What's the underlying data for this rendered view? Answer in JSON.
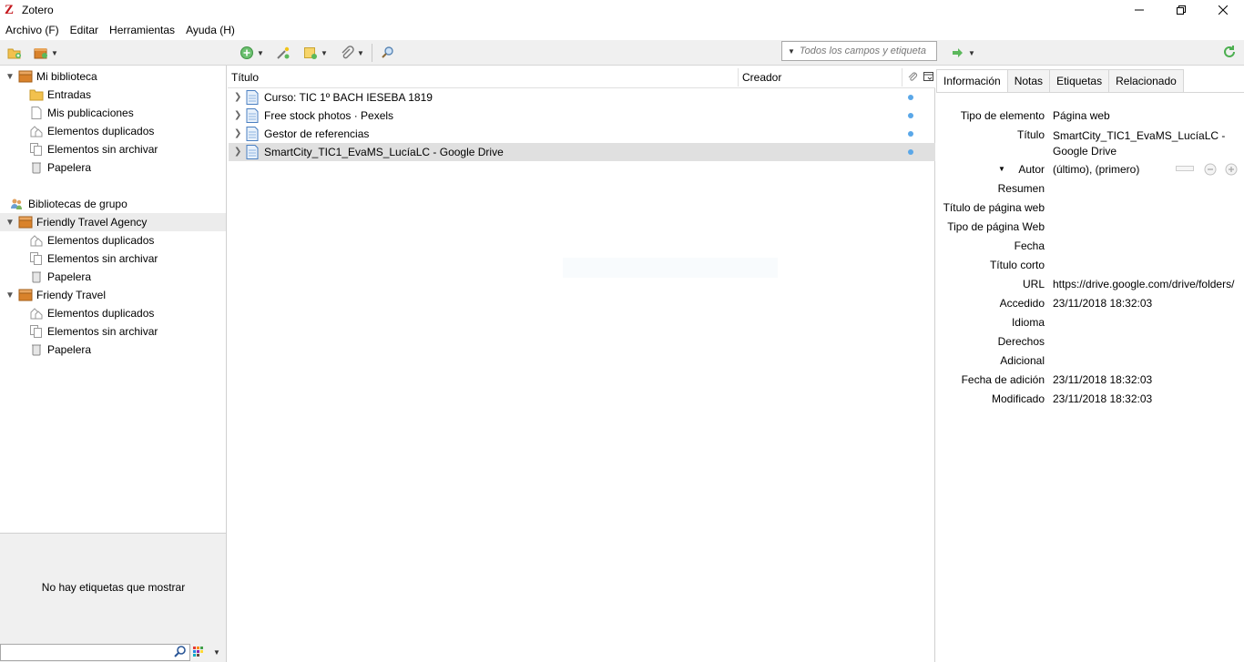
{
  "window": {
    "title": "Zotero",
    "logo_letter": "Z",
    "minimize": "—",
    "restore": "❐",
    "close": "✕"
  },
  "menu": [
    {
      "label": "Archivo (F)"
    },
    {
      "label": "Editar"
    },
    {
      "label": "Herramientas"
    },
    {
      "label": "Ayuda (H)"
    }
  ],
  "search": {
    "placeholder": "Todos los campos y etiqueta"
  },
  "collections": {
    "my_library": "Mi biblioteca",
    "entries": "Entradas",
    "my_publications": "Mis publicaciones",
    "duplicates": "Elementos duplicados",
    "unfiled": "Elementos sin archivar",
    "trash": "Papelera",
    "group_libraries": "Bibliotecas de grupo",
    "group1": "Friendly Travel Agency",
    "group1_duplicates": "Elementos duplicados",
    "group1_unfiled": "Elementos sin archivar",
    "group1_trash": "Papelera",
    "group2": "Friendy Travel",
    "group2_duplicates": "Elementos duplicados",
    "group2_unfiled": "Elementos sin archivar",
    "group2_trash": "Papelera"
  },
  "tags": {
    "empty_message": "No hay etiquetas que mostrar"
  },
  "items": {
    "columns": {
      "title": "Título",
      "creator": "Creador"
    },
    "rows": [
      {
        "title": "Curso: TIC 1º BACH IESEBA 1819",
        "selected": false
      },
      {
        "title": "Free stock photos · Pexels",
        "selected": false
      },
      {
        "title": "Gestor de referencias",
        "selected": false
      },
      {
        "title": "SmartCity_TIC1_EvaMS_LucíaLC - Google Drive",
        "selected": true
      }
    ]
  },
  "item_pane": {
    "tabs": [
      "Información",
      "Notas",
      "Etiquetas",
      "Relacionado"
    ],
    "active_tab": "Información",
    "fields": {
      "item_type_label": "Tipo de elemento",
      "item_type_value": "Página web",
      "title_label": "Título",
      "title_value": "SmartCity_TIC1_EvaMS_LucíaLC - Google Drive",
      "author_label": "Autor",
      "author_value": "(último), (primero)",
      "abstract_label": "Resumen",
      "website_title_label": "Título de página web",
      "website_type_label": "Tipo de página Web",
      "date_label": "Fecha",
      "short_title_label": "Título corto",
      "url_label": "URL",
      "url_value": "https://drive.google.com/drive/folders/",
      "accessed_label": "Accedido",
      "accessed_value": "23/11/2018 18:32:03",
      "language_label": "Idioma",
      "rights_label": "Derechos",
      "extra_label": "Adicional",
      "date_added_label": "Fecha de adición",
      "date_added_value": "23/11/2018 18:32:03",
      "modified_label": "Modificado",
      "modified_value": "23/11/2018 18:32:03"
    }
  },
  "colors": {
    "library_icon": "#d9822b",
    "folder_icon": "#f2c14e",
    "attachment_dot": "#5aa7e8",
    "item_icon": "#4a7fc1",
    "selection": "#e0e0e0"
  }
}
